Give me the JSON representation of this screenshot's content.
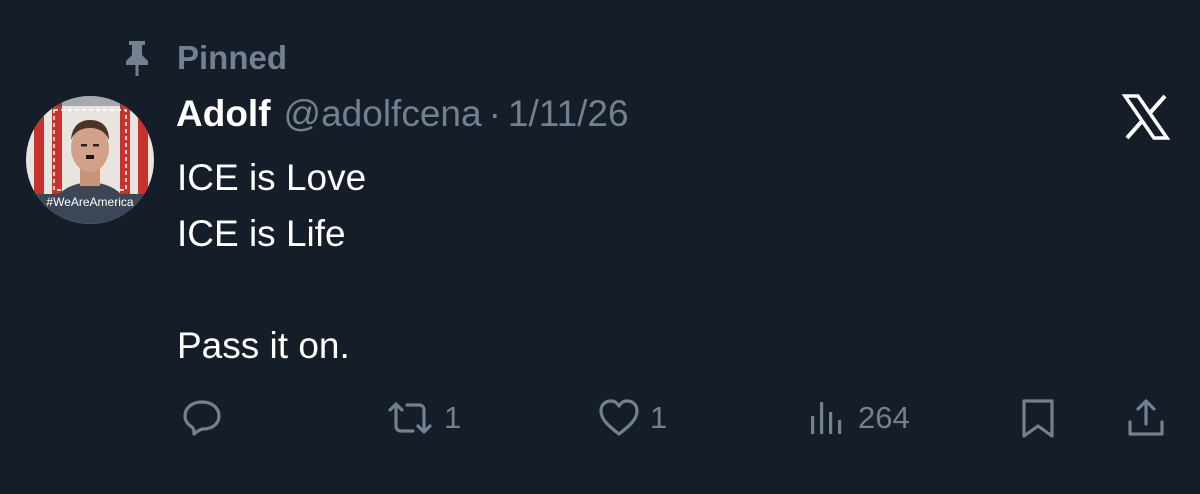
{
  "pinned": {
    "label": "Pinned",
    "icon": "pin-icon"
  },
  "author": {
    "display_name": "Adolf",
    "handle": "@adolfcena",
    "separator": "·",
    "date": "1/11/26",
    "avatar_caption": "#WeAreAmerica"
  },
  "platform_logo": "x-logo-icon",
  "tweet": {
    "lines": [
      "ICE is Love",
      "ICE is Life",
      "",
      "Pass it on."
    ]
  },
  "actions": {
    "reply": {
      "icon": "reply-icon",
      "count": ""
    },
    "repost": {
      "icon": "repost-icon",
      "count": "1"
    },
    "like": {
      "icon": "heart-icon",
      "count": "1"
    },
    "views": {
      "icon": "views-icon",
      "count": "264"
    },
    "bookmark": {
      "icon": "bookmark-icon"
    },
    "share": {
      "icon": "share-icon"
    }
  },
  "colors": {
    "background": "#151d28",
    "primary_text": "#ffffff",
    "secondary_text": "#72808f"
  }
}
